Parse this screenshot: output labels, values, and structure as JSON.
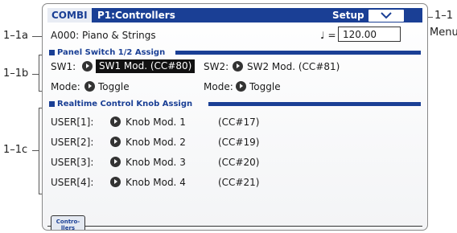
{
  "callouts": {
    "menu_ref": "1–1",
    "menu_word": "Menu",
    "c1a": "1–1a",
    "c1b": "1–1b",
    "c1c": "1–1c"
  },
  "header": {
    "mode": "COMBI",
    "page": "P1:Controllers",
    "setup": "Setup",
    "menu_icon": "chevron-down-icon"
  },
  "program": {
    "number": "A000",
    "name": ": Piano & Strings",
    "tempo_symbol": "♩ =",
    "tempo_value": "120.00"
  },
  "panel_switch": {
    "heading": "Panel Switch 1/2 Assign",
    "sw1_label": "SW1:",
    "sw1_value": "SW1 Mod. (CC#80)",
    "sw2_label": "SW2:",
    "sw2_value": "SW2 Mod. (CC#81)",
    "mode1_label": "Mode:",
    "mode1_value": "Toggle",
    "mode2_label": "Mode:",
    "mode2_value": "Toggle"
  },
  "realtime": {
    "heading": "Realtime Control Knob Assign",
    "rows": [
      {
        "label": "USER[1]:",
        "value": "Knob Mod. 1",
        "cc": "(CC#17)"
      },
      {
        "label": "USER[2]:",
        "value": "Knob Mod. 2",
        "cc": "(CC#19)"
      },
      {
        "label": "USER[3]:",
        "value": "Knob Mod. 3",
        "cc": "(CC#20)"
      },
      {
        "label": "USER[4]:",
        "value": "Knob Mod. 4",
        "cc": "(CC#21)"
      }
    ]
  },
  "tabs": {
    "controllers_line1": "Contro-",
    "controllers_line2": "llers"
  },
  "colors": {
    "accent": "#1a3f95",
    "selected_bg": "#111111"
  }
}
